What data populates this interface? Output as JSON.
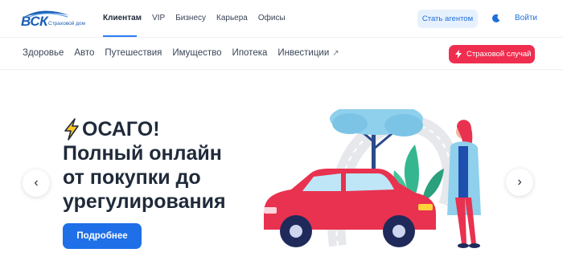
{
  "header": {
    "logo_text": "ВСК",
    "logo_sub": "Страховой дом",
    "nav": [
      "Клиентам",
      "VIP",
      "Бизнесу",
      "Карьера",
      "Офисы"
    ],
    "agent_button": "Стать агентом",
    "theme_icon": "moon-icon",
    "login": "Войти"
  },
  "subnav": {
    "items": [
      "Здоровье",
      "Авто",
      "Путешествия",
      "Имущество",
      "Ипотека",
      "Инвестиции"
    ],
    "external_icon": "↗",
    "claim_button": "Страховой случай"
  },
  "hero": {
    "title_lines": [
      "ОСАГО!",
      "Полный онлайн",
      "от покупки до",
      "урегулирования"
    ],
    "cta": "Подробнее",
    "prev_icon": "‹",
    "next_icon": "›"
  },
  "colors": {
    "brand": "#1a5fb4",
    "accent": "#1e6fe8",
    "claim": "#ef2e4f",
    "car": "#e8324f"
  }
}
